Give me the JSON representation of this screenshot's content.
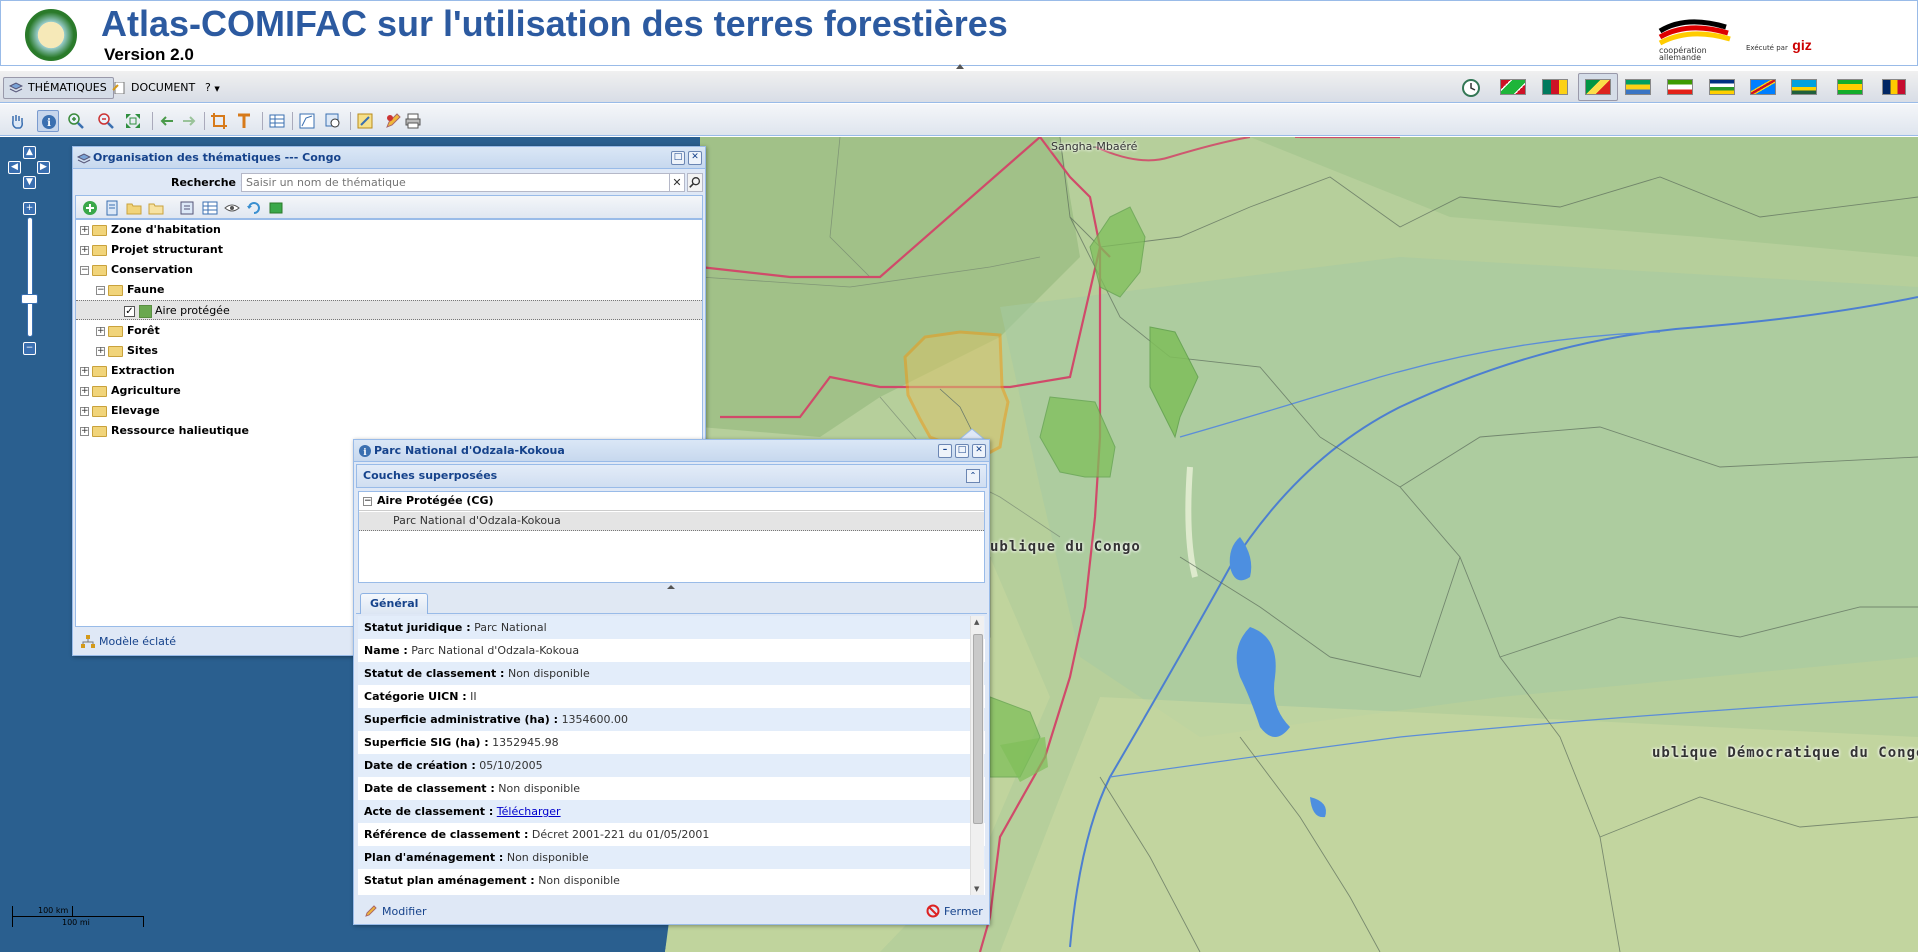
{
  "header": {
    "title": "Atlas-COMIFAC sur l'utilisation des terres forestières",
    "version": "Version 2.0",
    "coop_text": "coopération allemande",
    "executed_by": "Exécuté par",
    "giz": "giz"
  },
  "menubar": {
    "items": [
      {
        "label": "THÉMATIQUES",
        "icon": "layers-icon",
        "active": true
      },
      {
        "label": "DOCUMENT",
        "icon": "document-icon",
        "active": false
      },
      {
        "label": "?",
        "icon": "help-icon",
        "active": false
      }
    ],
    "flags": [
      "Burundi",
      "Cameroun",
      "Congo",
      "Gabon",
      "Guinée équatoriale",
      "République centrafricaine",
      "RD Congo",
      "Rwanda",
      "Sao Tomé-et-Principe",
      "Tchad"
    ],
    "active_flag": "Congo"
  },
  "themes_panel": {
    "title": "Organisation des thématiques --- Congo",
    "search_label": "Recherche :",
    "search_placeholder": "Saisir un nom de thématique",
    "tree": [
      {
        "label": "Zone d'habitation"
      },
      {
        "label": "Projet structurant"
      },
      {
        "label": "Conservation"
      },
      {
        "label": "Faune"
      },
      {
        "label": "Aire protégée"
      },
      {
        "label": "Forêt"
      },
      {
        "label": "Sites"
      },
      {
        "label": "Extraction"
      },
      {
        "label": "Agriculture"
      },
      {
        "label": "Elevage"
      },
      {
        "label": "Ressource halieutique"
      }
    ],
    "footer_label": "Modèle éclaté"
  },
  "info_panel": {
    "title": "Parc National d'Odzala-Kokoua",
    "section_title": "Couches superposées",
    "layer_group": "Aire Protégée (CG)",
    "layer_item": "Parc National d'Odzala-Kokoua",
    "tab": "Général",
    "attributes": [
      {
        "key": "Statut juridique :",
        "value": "Parc National"
      },
      {
        "key": "Name :",
        "value": "Parc National d'Odzala-Kokoua"
      },
      {
        "key": "Statut de classement :",
        "value": "Non disponible"
      },
      {
        "key": "Catégorie UICN :",
        "value": "II"
      },
      {
        "key": "Superficie administrative (ha) :",
        "value": "1354600.00"
      },
      {
        "key": "Superficie SIG (ha) :",
        "value": "1352945.98"
      },
      {
        "key": "Date de création :",
        "value": "05/10/2005"
      },
      {
        "key": "Date de classement :",
        "value": "Non disponible"
      },
      {
        "key": "Acte de classement :",
        "value": "Télécharger"
      },
      {
        "key": "Référence de classement :",
        "value": "Décret 2001-221 du 01/05/2001"
      },
      {
        "key": "Plan d'aménagement :",
        "value": "Non disponible"
      },
      {
        "key": "Statut plan aménagement :",
        "value": "Non disponible"
      }
    ],
    "modify_label": "Modifier",
    "close_label": "Fermer"
  },
  "map": {
    "labels": {
      "sangha": "Sangha-Mbaéré",
      "congo": "ublique du Congo",
      "rdc": "ublique Démocratique du Congo"
    },
    "scale": {
      "km": "100 km",
      "mi": "100 mi"
    }
  },
  "colors": {
    "panel_header": "#c7d8ee",
    "title_blue": "#2c5aa0",
    "protected_area": "#6aa84f",
    "selected_area": "#f29a14",
    "border_red": "#d04a6a"
  }
}
